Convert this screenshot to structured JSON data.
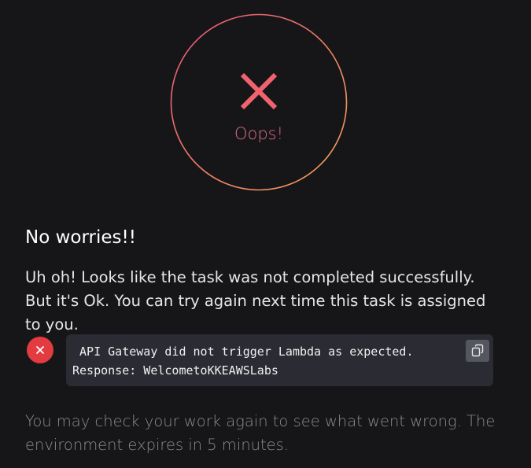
{
  "status": {
    "title": "Oops!",
    "ring_gradient": [
      "#e8547a",
      "#f4a35a"
    ],
    "x_color": "#f0636e"
  },
  "result": {
    "heading": "No worries!!",
    "message": "Uh oh! Looks like the task was not completed successfully. But it's Ok. You can try again next time this task is assigned to you."
  },
  "error": {
    "icon": "close-icon",
    "badge_color": "#e23b40",
    "line1": " API Gateway did not trigger Lambda as expected.",
    "line2": "Response: WelcometoKKEAWSLabs",
    "copy_icon": "copy-icon"
  },
  "footer": {
    "text": "You may check your work again to see what went wrong. The environment expires in 5 minutes."
  }
}
